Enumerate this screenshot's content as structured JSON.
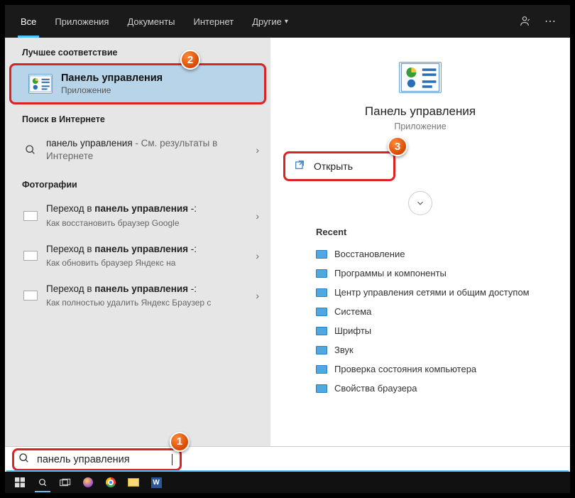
{
  "tabs": {
    "t0": "Все",
    "t1": "Приложения",
    "t2": "Документы",
    "t3": "Интернет",
    "t4": "Другие"
  },
  "left": {
    "best_header": "Лучшее соответствие",
    "best_title": "Панель управления",
    "best_sub": "Приложение",
    "web_header": "Поиск в Интернете",
    "web_main_prefix": "панель управления",
    "web_main_suffix": " - См. результаты в Интернете",
    "photos_header": "Фотографии",
    "p1_main": "Переход в панель управления -:",
    "p1_sub": "Как восстановить браузер Google",
    "p2_main": "Переход в панель управления -:",
    "p2_sub": "Как обновить браузер Яндекс на",
    "p3_main": "Переход в панель управления -:",
    "p3_sub": "Как полностью удалить Яндекс Браузер с"
  },
  "right": {
    "title": "Панель управления",
    "sub": "Приложение",
    "open": "Открыть",
    "recent_hdr": "Recent",
    "r0": "Восстановление",
    "r1": "Программы и компоненты",
    "r2": "Центр управления сетями и общим доступом",
    "r3": "Система",
    "r4": "Шрифты",
    "r5": "Звук",
    "r6": "Проверка состояния компьютера",
    "r7": "Свойства браузера"
  },
  "search": {
    "value": "панель управления"
  },
  "badges": {
    "b1": "1",
    "b2": "2",
    "b3": "3"
  }
}
